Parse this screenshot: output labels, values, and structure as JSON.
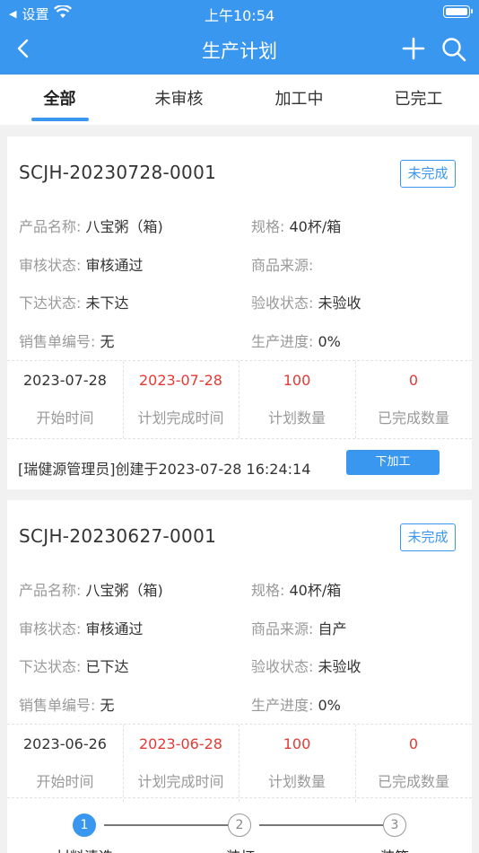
{
  "status_bar": {
    "carrier": "设置",
    "time": "上午10:54"
  },
  "nav": {
    "title": "生产计划"
  },
  "tabs": [
    {
      "label": "全部"
    },
    {
      "label": "未审核"
    },
    {
      "label": "加工中"
    },
    {
      "label": "已完工"
    }
  ],
  "cards": [
    {
      "plan_no": "SCJH-20230728-0001",
      "status": "未完成",
      "product_name_label": "产品名称:",
      "product_name": "八宝粥（箱)",
      "spec_label": "规格:",
      "spec": "40杯/箱",
      "review_label": "审核状态:",
      "review": "审核通过",
      "source_label": "商品来源:",
      "source": "",
      "issue_label": "下达状态:",
      "issue": "未下达",
      "acceptance_label": "验收状态:",
      "acceptance": "未验收",
      "sales_no_label": "销售单编号:",
      "sales_no": "无",
      "progress_label": "生产进度:",
      "progress": "0%",
      "start_date": "2023-07-28",
      "start_caption": "开始时间",
      "planned_date": "2023-07-28",
      "planned_caption": "计划完成时间",
      "planned_qty": "100",
      "planned_qty_caption": "计划数量",
      "done_qty": "0",
      "done_qty_caption": "已完成数量",
      "footer": "[瑞健源管理员]创建于2023-07-28 16:24:14",
      "action": "下加工"
    },
    {
      "plan_no": "SCJH-20230627-0001",
      "status": "未完成",
      "product_name_label": "产品名称:",
      "product_name": "八宝粥（箱)",
      "spec_label": "规格:",
      "spec": "40杯/箱",
      "review_label": "审核状态:",
      "review": "审核通过",
      "source_label": "商品来源:",
      "source": "自产",
      "issue_label": "下达状态:",
      "issue": "已下达",
      "acceptance_label": "验收状态:",
      "acceptance": "未验收",
      "sales_no_label": "销售单编号:",
      "sales_no": "无",
      "progress_label": "生产进度:",
      "progress": "0%",
      "start_date": "2023-06-26",
      "start_caption": "开始时间",
      "planned_date": "2023-06-28",
      "planned_caption": "计划完成时间",
      "planned_qty": "100",
      "planned_qty_caption": "计划数量",
      "done_qty": "0",
      "done_qty_caption": "已完成数量",
      "steps": [
        {
          "num": "1",
          "label": "材料清选"
        },
        {
          "num": "2",
          "label": "装杯"
        },
        {
          "num": "3",
          "label": "装箱"
        }
      ]
    }
  ],
  "colors": {
    "primary": "#3a97ef",
    "danger": "#e53935",
    "muted": "#999999"
  }
}
